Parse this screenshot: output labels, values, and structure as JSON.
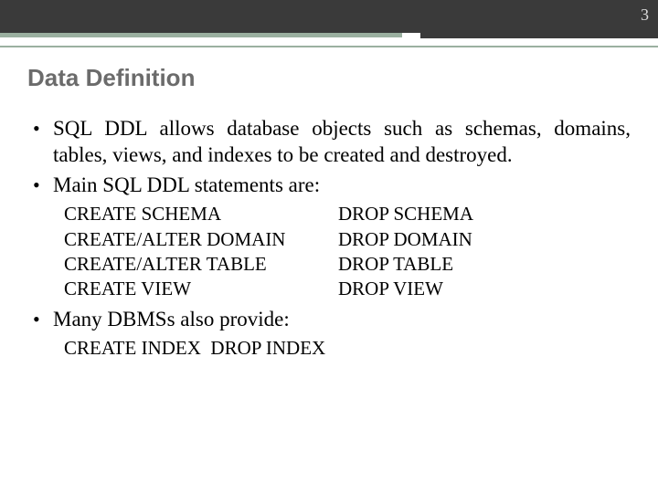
{
  "page_number": "3",
  "title": "Data Definition",
  "bullets": {
    "b1": "SQL DDL allows database objects such as schemas, domains, tables, views, and indexes to be created and destroyed.",
    "b2": "Main SQL DDL statements are:",
    "b3": "Many DBMSs also provide:"
  },
  "ddl": {
    "left": {
      "r1": "CREATE SCHEMA",
      "r2": "CREATE/ALTER DOMAIN",
      "r3": "CREATE/ALTER TABLE",
      "r4": "CREATE VIEW"
    },
    "right": {
      "r1": "DROP SCHEMA",
      "r2": "DROP DOMAIN",
      "r3": "DROP TABLE",
      "r4": "DROP VIEW"
    }
  },
  "index_row": "CREATE INDEX  DROP INDEX"
}
